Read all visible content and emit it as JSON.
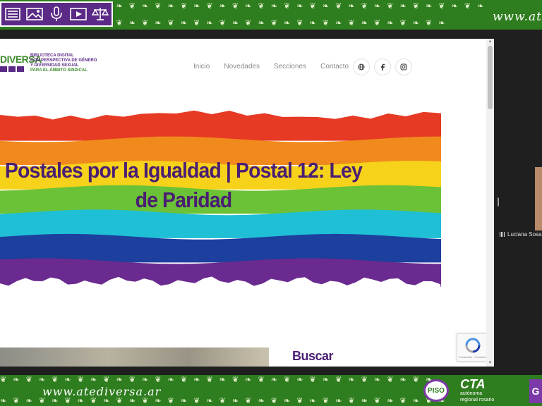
{
  "top_band": {
    "url_text": "www.at",
    "strip_icons": [
      "document-list-icon",
      "image-icon",
      "microphone-icon",
      "video-play-icon",
      "scales-icon"
    ]
  },
  "bottom_band": {
    "url_text": "www.atediversa.ar",
    "logo_piso": "PISO",
    "logo_cta": "CTA",
    "logo_cta_sub": "autónoma",
    "logo_cta_sub2": "regional rosario",
    "tab_letter": "G"
  },
  "site": {
    "logo_word": "DIVERSA",
    "logo_lines": [
      "BIBLIOTECA DIGITAL",
      "CON PERSPECTIVA DE GÉNERO",
      "Y DIVERSIDAD SEXUAL",
      "PARA EL ÁMBITO SINDICAL"
    ],
    "nav": [
      "Inicio",
      "Novedades",
      "Secciones",
      "Contacto"
    ],
    "social_icons": [
      "globe-icon",
      "facebook-icon",
      "instagram-icon"
    ]
  },
  "hero": {
    "title": "Postales por la Igualdad | Postal 12: Ley de Paridad",
    "stripe_colors": [
      "#e63a25",
      "#f08a1c",
      "#f6d21a",
      "#6cc236",
      "#1fbfd6",
      "#1d3f9e",
      "#6a2a8f"
    ]
  },
  "sidebar": {
    "search_heading": "Buscar"
  },
  "recaptcha": {
    "footer": "Privacidad - Condiciones"
  },
  "participant": {
    "name": "Luciana Sosa"
  },
  "colors": {
    "band_green": "#2e7d1e",
    "brand_purple": "#5b2a86",
    "title_purple": "#4a1e72",
    "logo_green": "#3d8a2a"
  }
}
